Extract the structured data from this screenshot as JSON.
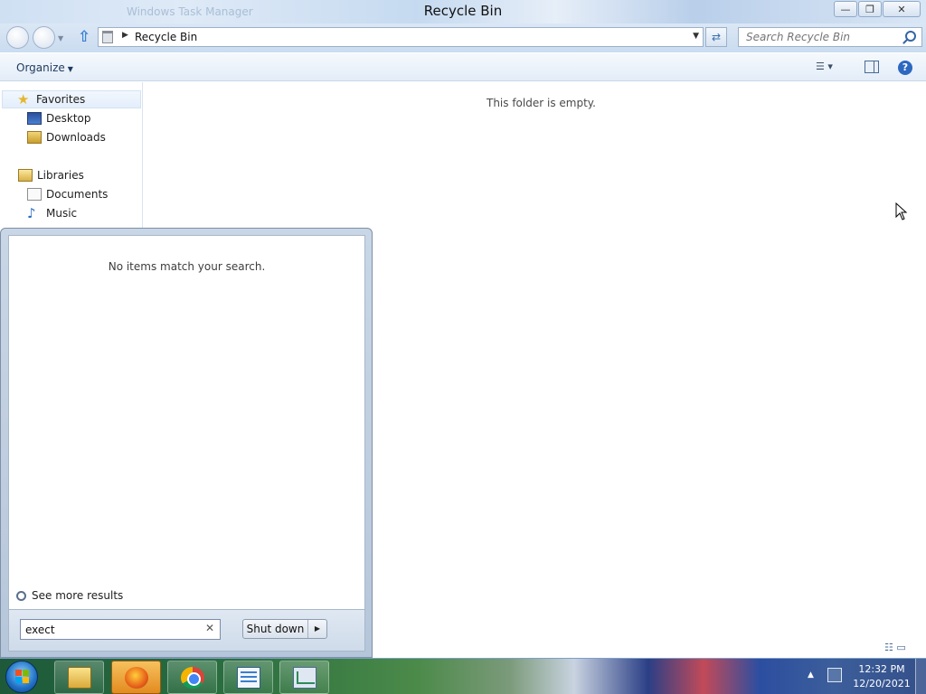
{
  "window": {
    "title": "Recycle Bin",
    "ghost_title": "Windows Task Manager",
    "controls": {
      "minimize": "—",
      "maximize": "❐",
      "close": "✕"
    }
  },
  "navigation": {
    "address": {
      "crumb": "Recycle Bin"
    },
    "search": {
      "placeholder": "Search Recycle Bin"
    }
  },
  "command_bar": {
    "organize_label": "Organize",
    "help_label": "?"
  },
  "nav_pane": {
    "favorites": {
      "label": "Favorites",
      "items": [
        "Desktop",
        "Downloads"
      ]
    },
    "libraries": {
      "label": "Libraries",
      "items": [
        "Documents",
        "Music"
      ]
    }
  },
  "content": {
    "empty_message": "This folder is empty."
  },
  "start_menu": {
    "no_results": "No items match your search.",
    "see_more": "See more results",
    "search_value": "exect",
    "shutdown_label": "Shut down"
  },
  "taskbar": {
    "apps": [
      "Windows Explorer",
      "Firefox",
      "Google Chrome",
      "Notepad",
      "Task Manager"
    ],
    "active_app": "Firefox",
    "clock": {
      "time": "12:32 PM",
      "date": "12/20/2021"
    }
  }
}
